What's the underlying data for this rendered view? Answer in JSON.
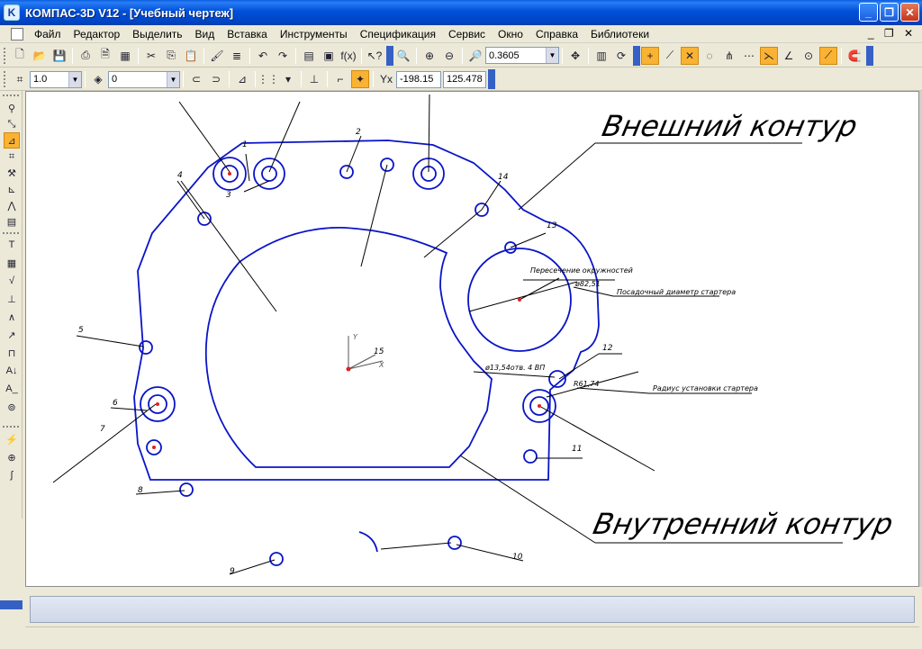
{
  "window": {
    "title": "КОМПАС-3D V12 - [Учебный чертеж]",
    "controls": [
      "_",
      "❐",
      "✕"
    ]
  },
  "menu": {
    "items": [
      "Файл",
      "Редактор",
      "Выделить",
      "Вид",
      "Вставка",
      "Инструменты",
      "Спецификация",
      "Сервис",
      "Окно",
      "Справка",
      "Библиотеки"
    ],
    "mdi_controls": "_ ❐ ✕"
  },
  "toolbar_standard": {
    "zoom_value": "0.3605"
  },
  "toolbar_current_state": {
    "step_value": "1.0",
    "layer_value": "0",
    "coord_x": "-198.15",
    "coord_y": "125.478"
  },
  "drawing": {
    "labels": {
      "outer_contour": "Внешний контур",
      "inner_contour": "Внутренний контур"
    },
    "annotations": [
      "Пересечение окружностей",
      "Посадочный диаметр стартера",
      "Радиус установки стартера",
      "ø82,51",
      "R61,74",
      "ø13,54отв. 4 ВП"
    ],
    "callout_numbers": [
      "1",
      "2",
      "3",
      "4",
      "5",
      "6",
      "7",
      "8",
      "9",
      "10",
      "11",
      "12",
      "13",
      "14",
      "15"
    ],
    "axis_labels": {
      "x": "X",
      "y": "Y"
    }
  },
  "colors": {
    "geometry": "#0a14c8",
    "text": "#000000",
    "accent_point": "#e02020",
    "title_bar": "#0050d8",
    "highlight": "#f9b232"
  }
}
